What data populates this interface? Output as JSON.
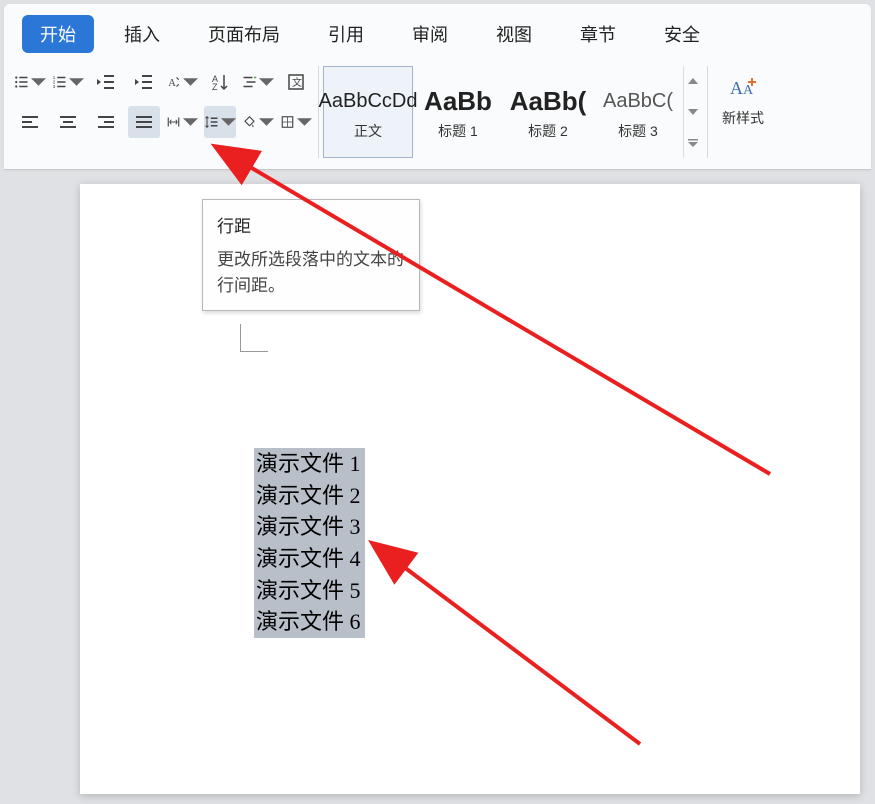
{
  "tabs": {
    "home": "开始",
    "insert": "插入",
    "layout": "页面布局",
    "references": "引用",
    "review": "审阅",
    "view": "视图",
    "chapter": "章节",
    "security": "安全"
  },
  "styles": {
    "normal": {
      "preview": "AaBbCcDd",
      "label": "正文"
    },
    "h1": {
      "preview": "AaBb",
      "label": "标题 1"
    },
    "h2": {
      "preview": "AaBb(",
      "label": "标题 2"
    },
    "h3": {
      "preview": "AaBbC(",
      "label": "标题 3"
    }
  },
  "newstyle_label": "新样式",
  "tooltip": {
    "title": "行距",
    "desc": "更改所选段落中的文本的行间距。"
  },
  "document": {
    "lines": [
      "演示文件 1",
      "演示文件 2",
      "演示文件 3",
      "演示文件 4",
      "演示文件 5",
      "演示文件 6"
    ]
  }
}
